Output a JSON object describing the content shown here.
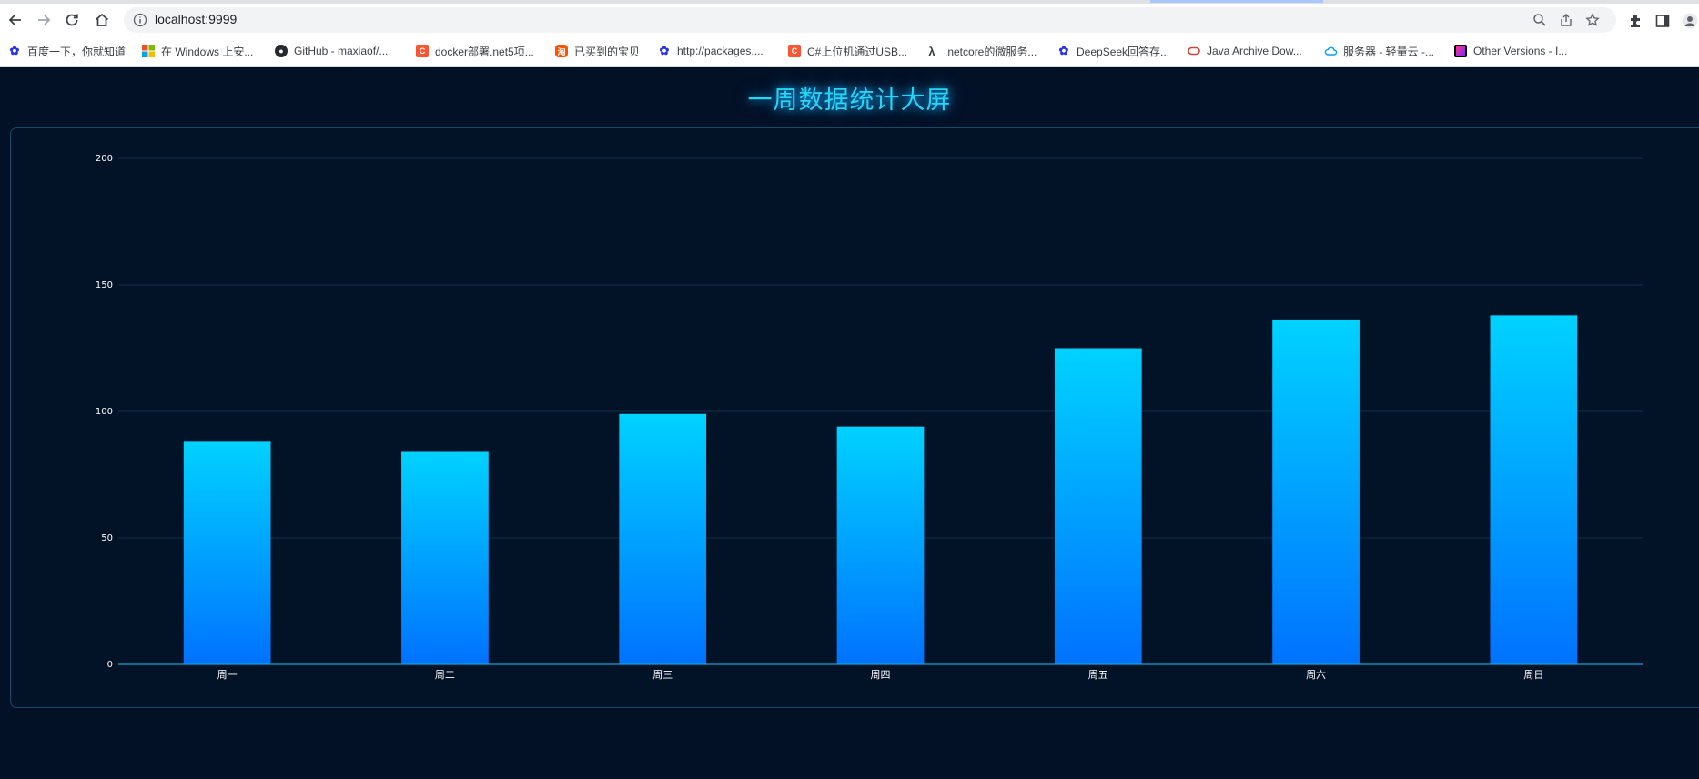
{
  "browser": {
    "url": "localhost:9999",
    "bookmarks": [
      {
        "label": "百度一下，你就知道",
        "icon": "baidu-paw-icon"
      },
      {
        "label": "在 Windows 上安...",
        "icon": "windows-logo-icon"
      },
      {
        "label": "GitHub - maxiaof/...",
        "icon": "github-icon"
      },
      {
        "label": "docker部署.net5项...",
        "icon": "csdn-icon"
      },
      {
        "label": "已买到的宝贝",
        "icon": "taobao-icon"
      },
      {
        "label": "http://packages....",
        "icon": "baidu-paw-icon"
      },
      {
        "label": "C#上位机通过USB...",
        "icon": "csdn-icon"
      },
      {
        "label": ".netcore的微服务...",
        "icon": "lambda-icon"
      },
      {
        "label": "DeepSeek回答存...",
        "icon": "baidu-paw-icon"
      },
      {
        "label": "Java Archive Dow...",
        "icon": "oracle-icon"
      },
      {
        "label": "服务器 - 轻量云 -...",
        "icon": "cloud-icon"
      },
      {
        "label": "Other Versions - I...",
        "icon": "jetbrains-icon"
      }
    ]
  },
  "dashboard": {
    "title": "一周数据统计大屏"
  },
  "chart_data": {
    "type": "bar",
    "categories": [
      "周一",
      "周二",
      "周三",
      "周四",
      "周五",
      "周六",
      "周日"
    ],
    "values": [
      88,
      84,
      99,
      94,
      125,
      136,
      138
    ],
    "ylim": [
      0,
      200
    ],
    "yticks": [
      0,
      50,
      100,
      150,
      200
    ],
    "title": "",
    "xlabel": "",
    "ylabel": "",
    "grid": true,
    "legend": "none",
    "colors": {
      "bar_top": "#00d2ff",
      "bar_bottom": "#0072ff",
      "axis": "#1e9fd0",
      "grid": "#12314a",
      "tick_text": "#ffffff"
    }
  }
}
